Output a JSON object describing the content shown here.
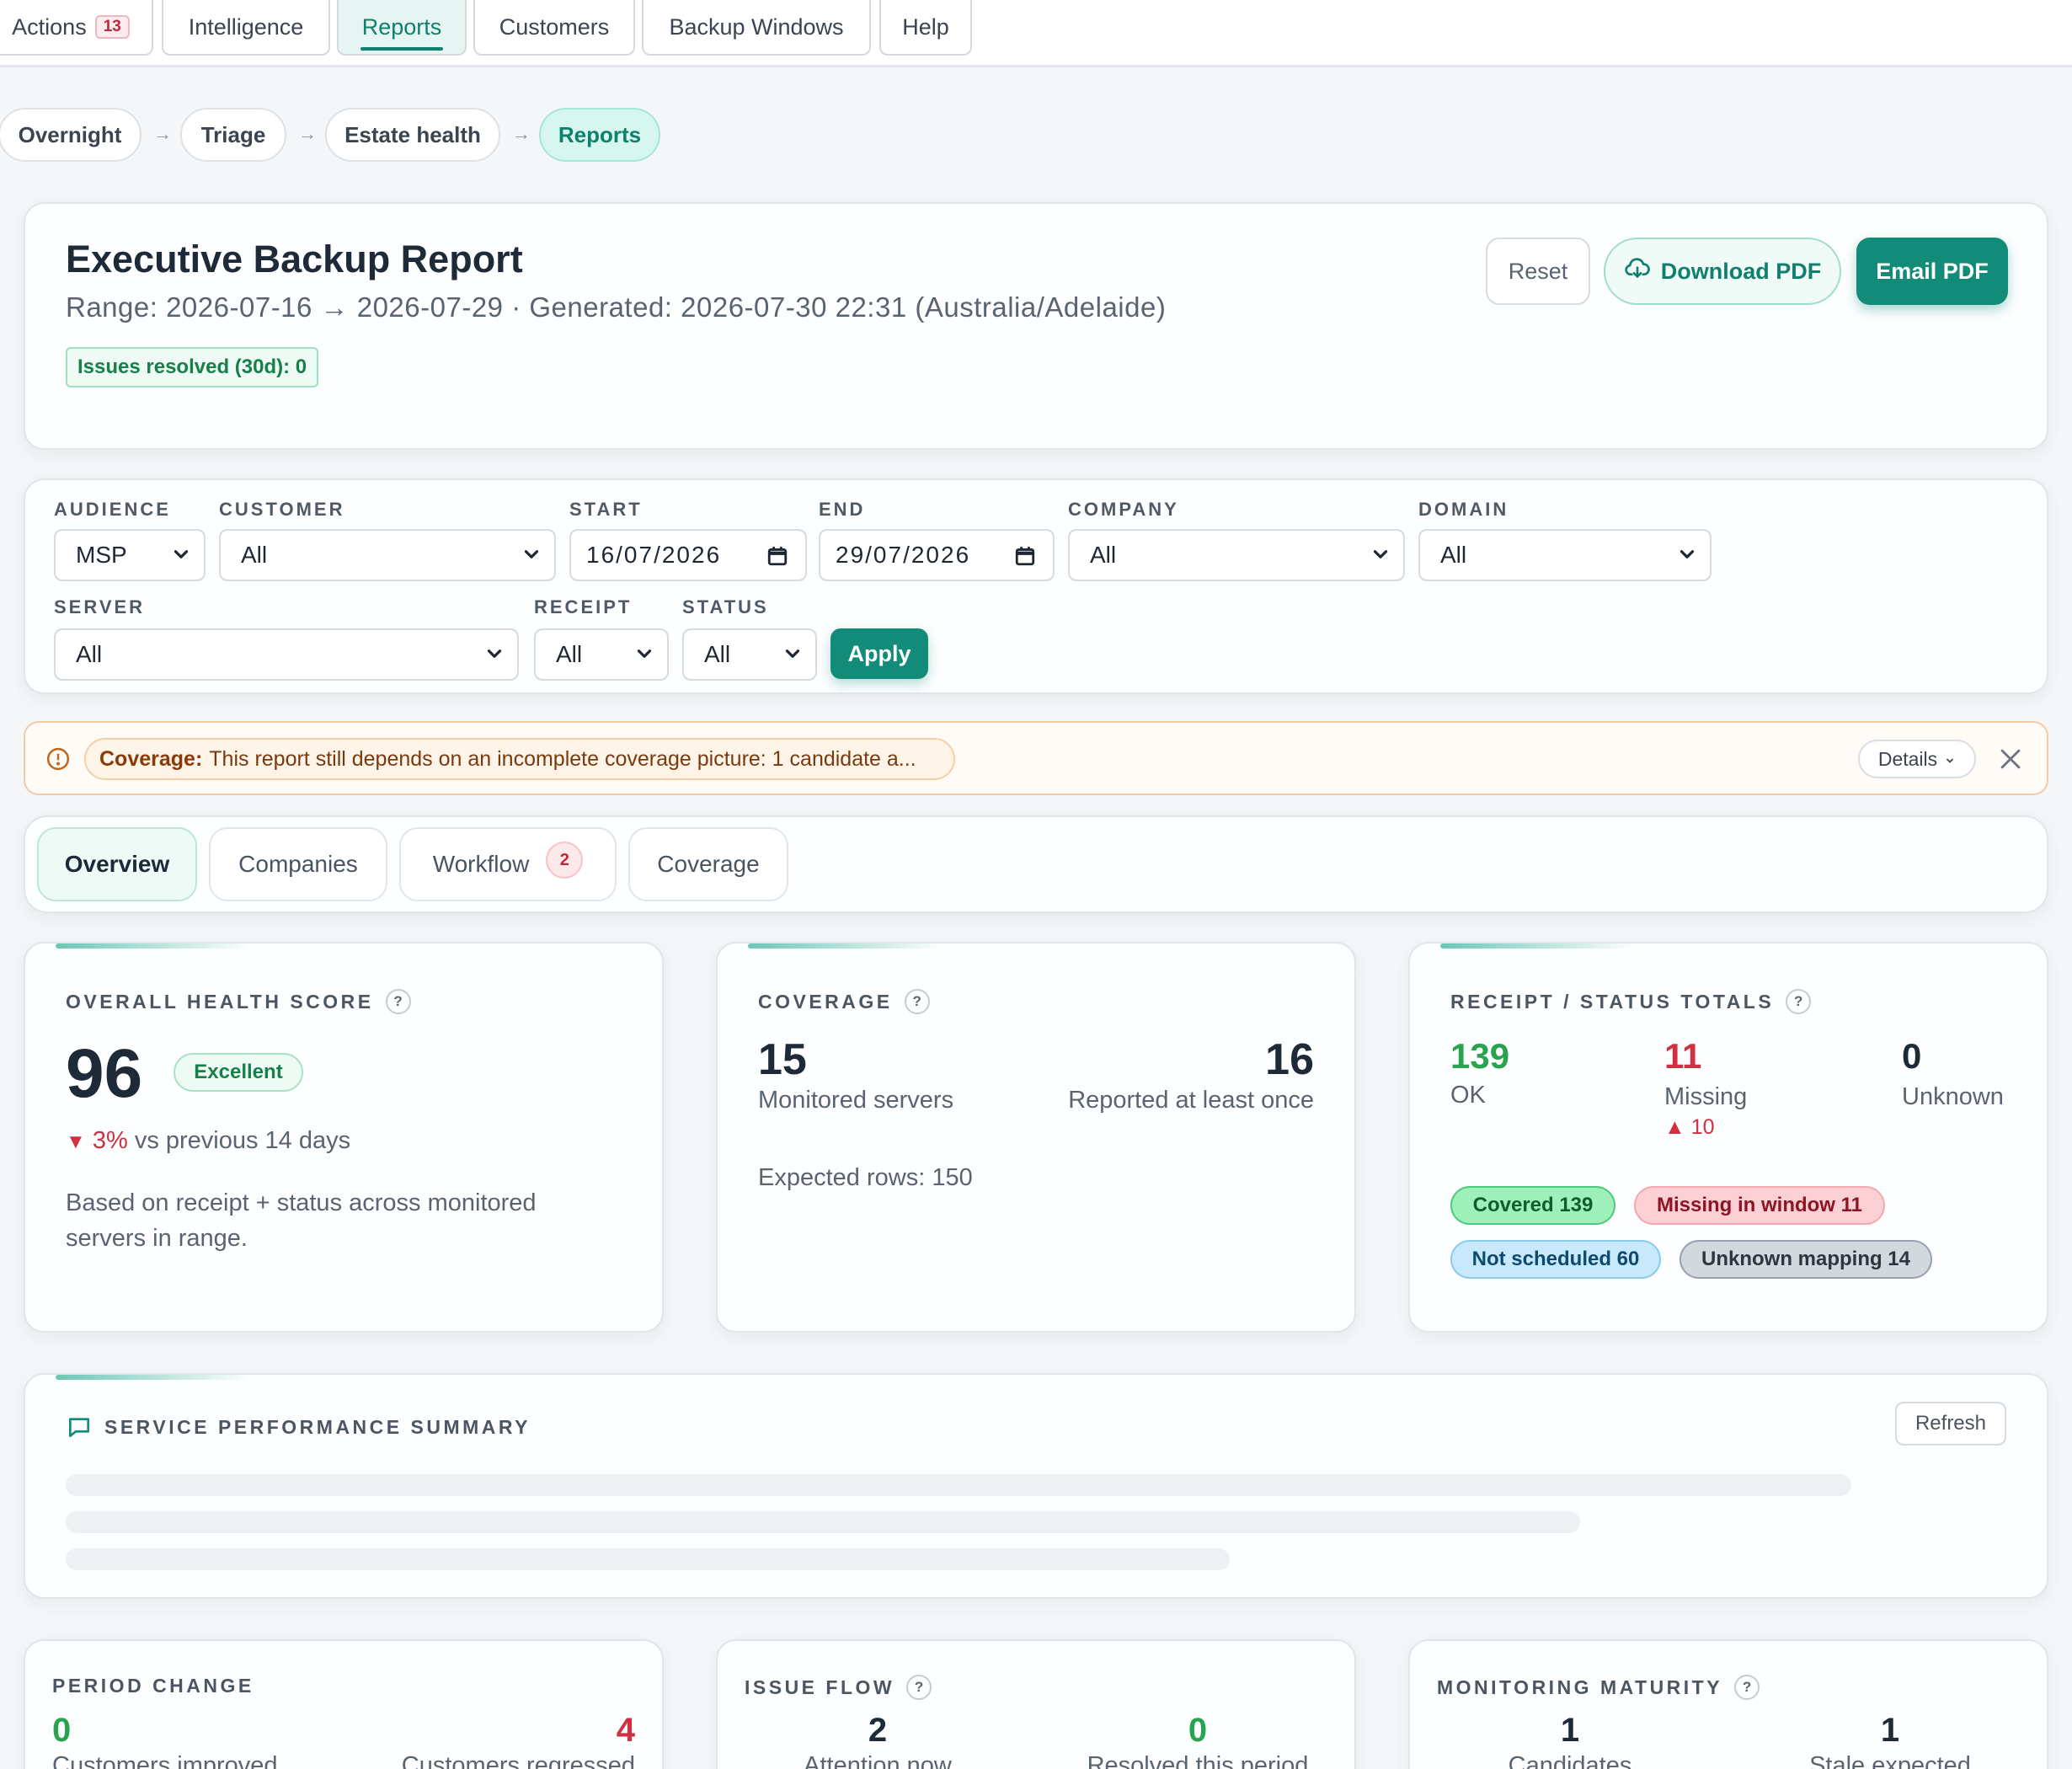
{
  "nav": {
    "actions_label": "Actions",
    "actions_count": "13",
    "tabs": [
      "Intelligence",
      "Reports",
      "Customers",
      "Backup Windows",
      "Help"
    ]
  },
  "breadcrumb": [
    "Overnight",
    "Triage",
    "Estate health",
    "Reports"
  ],
  "breadcrumb_separator": "→",
  "header": {
    "title": "Executive Backup Report",
    "range": "Range: 2026-07-16 → 2026-07-29 · Generated: 2026-07-30 22:31 (Australia/Adelaide)",
    "issues_badge": "Issues resolved (30d): 0",
    "reset_label": "Reset",
    "download_label": "Download PDF",
    "email_label": "Email PDF"
  },
  "filters": {
    "audience": {
      "label": "AUDIENCE",
      "value": "MSP"
    },
    "customer": {
      "label": "CUSTOMER",
      "value": "All"
    },
    "start": {
      "label": "START",
      "value": "16/07/2026"
    },
    "end": {
      "label": "END",
      "value": "29/07/2026"
    },
    "company": {
      "label": "COMPANY",
      "value": "All"
    },
    "domain": {
      "label": "DOMAIN",
      "value": "All"
    },
    "server": {
      "label": "SERVER",
      "value": "All"
    },
    "receipt": {
      "label": "RECEIPT",
      "value": "All"
    },
    "status": {
      "label": "STATUS",
      "value": "All"
    },
    "apply_label": "Apply"
  },
  "alert": {
    "title": "Coverage:",
    "message": "This report still depends on an incomplete coverage picture: 1 candidate a...",
    "details_label": "Details"
  },
  "tabs": [
    {
      "label": "Overview"
    },
    {
      "label": "Companies"
    },
    {
      "label": "Workflow",
      "badge": "2"
    },
    {
      "label": "Coverage"
    }
  ],
  "health": {
    "label": "OVERALL HEALTH SCORE",
    "score": "96",
    "rating": "Excellent",
    "delta": "3%",
    "delta_text": "vs previous 14 days",
    "note_line1": "Based on receipt + status across monitored",
    "note_line2": "servers in range."
  },
  "coverage": {
    "label": "COVERAGE",
    "monitored_value": "15",
    "monitored_label": "Monitored servers",
    "reported_value": "16",
    "reported_label": "Reported at least once",
    "expected_rows": "Expected rows: 150"
  },
  "receipt": {
    "label": "RECEIPT / STATUS TOTALS",
    "ok_value": "139",
    "ok_label": "OK",
    "missing_value": "11",
    "missing_label": "Missing",
    "missing_delta": "10",
    "unknown_value": "0",
    "unknown_label": "Unknown",
    "pills": {
      "covered": "Covered 139",
      "missing_window": "Missing in window 11",
      "not_scheduled": "Not scheduled 60",
      "unknown_mapping": "Unknown mapping 14"
    }
  },
  "summary": {
    "label": "SERVICE PERFORMANCE SUMMARY",
    "refresh_label": "Refresh"
  },
  "period_change": {
    "label": "PERIOD CHANGE",
    "improved_value": "0",
    "improved_label": "Customers improved",
    "regressed_value": "4",
    "regressed_label": "Customers regressed"
  },
  "issue_flow": {
    "label": "ISSUE FLOW",
    "attention_value": "2",
    "attention_label": "Attention now",
    "resolved_value": "0",
    "resolved_label": "Resolved this period"
  },
  "maturity": {
    "label": "MONITORING MATURITY",
    "candidates_value": "1",
    "candidates_label": "Candidates",
    "stale_value": "1",
    "stale_label": "Stale expected"
  },
  "colors": {
    "accent": "#128b78",
    "good": "#2aa34f",
    "bad": "#d0303f",
    "warning_border": "#f5c9a2"
  }
}
